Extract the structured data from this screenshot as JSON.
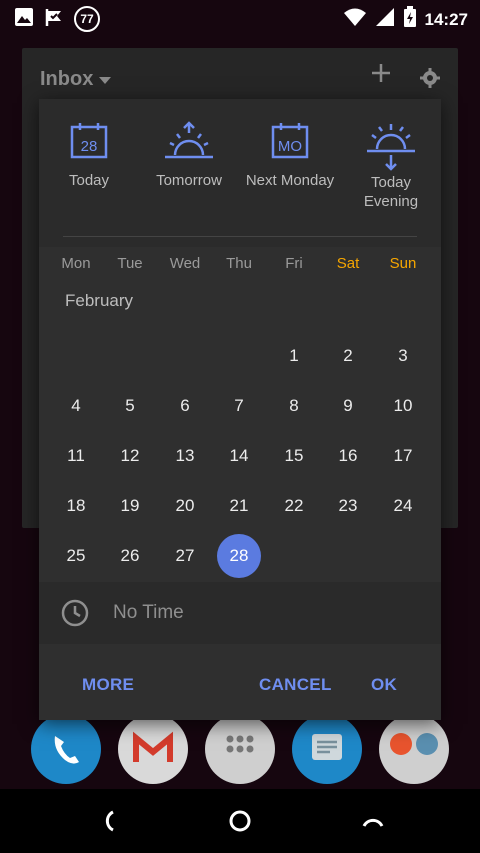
{
  "status_bar": {
    "time": "14:27",
    "badge_count": "77",
    "icons": [
      "image-icon",
      "check-flag-icon",
      "badge-77-icon",
      "wifi-icon",
      "signal-icon",
      "battery-icon"
    ]
  },
  "background_app": {
    "title": "Inbox"
  },
  "quick_options": [
    {
      "label_lines": [
        "Today"
      ],
      "icon": "calendar-28-icon",
      "icon_text": "28"
    },
    {
      "label_lines": [
        "Tomorrow"
      ],
      "icon": "sunrise-icon"
    },
    {
      "label_lines": [
        "Next Monday"
      ],
      "icon": "calendar-mo-icon",
      "icon_text": "MO"
    },
    {
      "label_lines": [
        "Today",
        "Evening"
      ],
      "icon": "sunset-icon"
    }
  ],
  "weekdays": [
    "Mon",
    "Tue",
    "Wed",
    "Thu",
    "Fri",
    "Sat",
    "Sun"
  ],
  "month": "February",
  "weeks": [
    [
      "",
      "",
      "",
      "",
      "1",
      "2",
      "3"
    ],
    [
      "4",
      "5",
      "6",
      "7",
      "8",
      "9",
      "10"
    ],
    [
      "11",
      "12",
      "13",
      "14",
      "15",
      "16",
      "17"
    ],
    [
      "18",
      "19",
      "20",
      "21",
      "22",
      "23",
      "24"
    ],
    [
      "25",
      "26",
      "27",
      "28",
      "",
      "",
      ""
    ]
  ],
  "selected_day": "28",
  "time_row": {
    "label": "No Time"
  },
  "buttons": {
    "more": "MORE",
    "cancel": "CANCEL",
    "ok": "OK"
  },
  "colors": {
    "accent": "#5b7be0",
    "weekend": "#f6a600",
    "button_text": "#6f8ef0",
    "dialog_bg": "#2f2f2f"
  }
}
